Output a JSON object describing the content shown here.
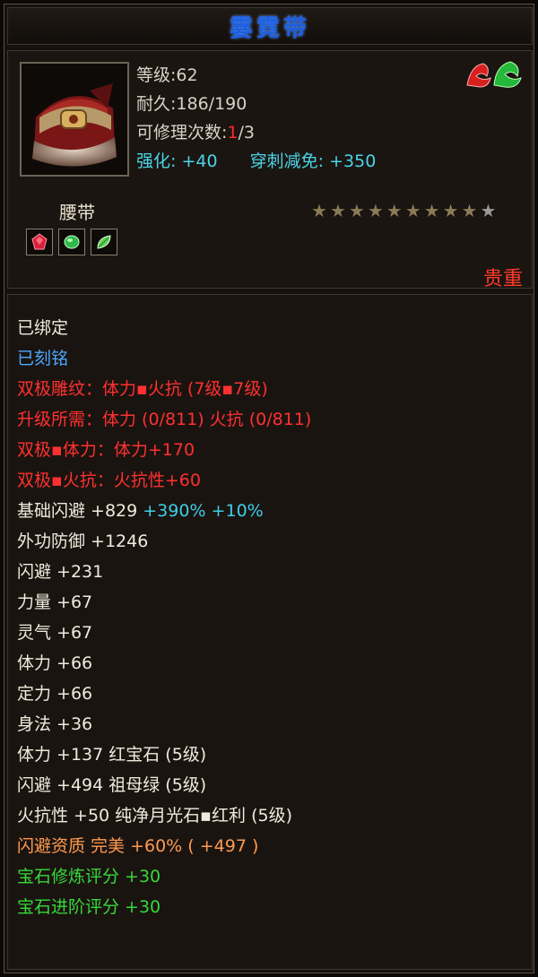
{
  "title": "霎霓带",
  "header": {
    "level_label": "等级:",
    "level_value": "62",
    "durability_label": "耐久:",
    "durability_value": "186/190",
    "repair_label": "可修理次数:",
    "repair_used": "1",
    "repair_total": "/3",
    "enhance_label": "强化:",
    "enhance_value": "+40",
    "pierce_label": "穿刺减免:",
    "pierce_value": "+350",
    "brand_icon": "dragon-emblem-icon"
  },
  "item_type": "腰带",
  "stars": {
    "filled": 9,
    "total": 10
  },
  "gem_slots": [
    {
      "icon": "red-gem-icon",
      "color": "#d8203a"
    },
    {
      "icon": "green-gem-icon",
      "color": "#2fb84a"
    },
    {
      "icon": "green-leaf-gem-icon",
      "color": "#5fcf5a"
    }
  ],
  "rarity": "贵重",
  "colors": {
    "title": "#1e5fe0",
    "red": "#ff3030",
    "cyan": "#4ad4e8",
    "green": "#36d83a",
    "orange": "#ff9a50"
  },
  "properties": {
    "bound": "已绑定",
    "engraved": "已刻铭",
    "pole_engrave": "双极雕纹：体力▪火抗 (7级▪7级)",
    "upgrade_need": "升级所需：体力 (0/811)  火抗 (0/811)",
    "pole_stamina": "双极▪体力：体力+170",
    "pole_fire": "双极▪火抗：火抗性+60",
    "base_dodge_label": "基础闪避 +829 ",
    "base_dodge_pct1": "+390%",
    "base_dodge_pct2": " +10%",
    "ext_defense": "外功防御 +1246",
    "dodge": "闪避 +231",
    "strength": "力量 +67",
    "spirit": "灵气 +67",
    "stamina": "体力 +66",
    "focus": "定力 +66",
    "agility": "身法 +36",
    "gem1": "体力 +137 红宝石 (5级)",
    "gem2": "闪避 +494 祖母绿 (5级)",
    "gem3": "火抗性 +50 纯净月光石▪红利 (5级)",
    "quality": "闪避资质  完美 +60% ( +497 )",
    "gem_refine": "宝石修炼评分 +30",
    "gem_advance": "宝石进阶评分 +30"
  }
}
